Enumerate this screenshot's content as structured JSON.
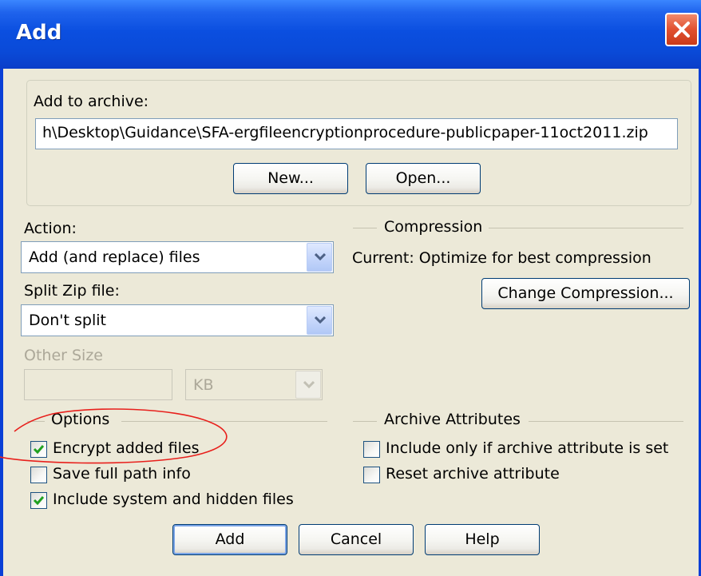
{
  "window": {
    "title": "Add"
  },
  "archive": {
    "label": "Add to archive:",
    "path": "h\\Desktop\\Guidance\\SFA-ergfileencryptionprocedure-publicpaper-11oct2011.zip",
    "new_button": "New...",
    "open_button": "Open..."
  },
  "action": {
    "label": "Action:",
    "selected": "Add (and replace) files"
  },
  "split": {
    "label": "Split Zip file:",
    "selected": "Don't split"
  },
  "other_size": {
    "label": "Other Size",
    "value": "",
    "unit": "KB"
  },
  "compression": {
    "header": "Compression",
    "current": "Current: Optimize for best compression",
    "change_button": "Change Compression..."
  },
  "options": {
    "header": "Options",
    "items": [
      {
        "label": "Encrypt added files",
        "checked": true
      },
      {
        "label": "Save full path info",
        "checked": false
      },
      {
        "label": "Include system and hidden files",
        "checked": true
      }
    ]
  },
  "archive_attributes": {
    "header": "Archive Attributes",
    "items": [
      {
        "label": "Include only if archive attribute is set",
        "checked": false
      },
      {
        "label": "Reset archive attribute",
        "checked": false
      }
    ]
  },
  "buttons": {
    "add": "Add",
    "cancel": "Cancel",
    "help": "Help"
  },
  "colors": {
    "titlebar": "#0a4ad8",
    "dialog_bg": "#ece9d8",
    "close_button": "#e1502f",
    "checkmark": "#21a121",
    "annotation": "#e8201c"
  }
}
